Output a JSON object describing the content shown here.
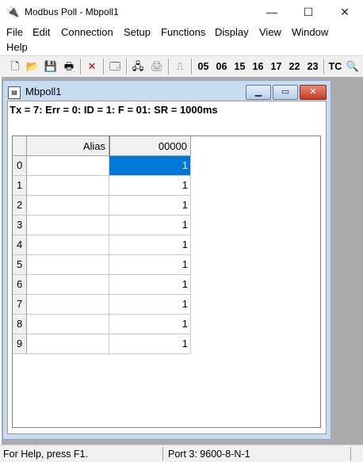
{
  "window": {
    "title": "Modbus Poll - Mbpoll1",
    "min_glyph": "—",
    "max_glyph": "☐",
    "close_glyph": "✕"
  },
  "menu": [
    "File",
    "Edit",
    "Connection",
    "Setup",
    "Functions",
    "Display",
    "View",
    "Window",
    "Help"
  ],
  "toolbar": {
    "icons": [
      "new-icon",
      "open-icon",
      "save-icon",
      "print-icon",
      "delete-icon",
      "window-icon",
      "connect-icon",
      "disconnect-icon",
      "pulse-icon"
    ],
    "function_codes": [
      "05",
      "06",
      "15",
      "16",
      "17",
      "22",
      "23"
    ],
    "tc_label": "TC"
  },
  "child": {
    "title": "Mbpoll1",
    "status_line": "Tx = 7: Err = 0: ID = 1: F = 01: SR = 1000ms",
    "grid": {
      "headers": [
        "Alias",
        "00000"
      ],
      "rows": [
        {
          "index": "0",
          "alias": "",
          "value": "1"
        },
        {
          "index": "1",
          "alias": "",
          "value": "1"
        },
        {
          "index": "2",
          "alias": "",
          "value": "1"
        },
        {
          "index": "3",
          "alias": "",
          "value": "1"
        },
        {
          "index": "4",
          "alias": "",
          "value": "1"
        },
        {
          "index": "5",
          "alias": "",
          "value": "1"
        },
        {
          "index": "6",
          "alias": "",
          "value": "1"
        },
        {
          "index": "7",
          "alias": "",
          "value": "1"
        },
        {
          "index": "8",
          "alias": "",
          "value": "1"
        },
        {
          "index": "9",
          "alias": "",
          "value": "1"
        }
      ],
      "selected_row": 0
    }
  },
  "statusbar": {
    "help": "For Help, press F1.",
    "port": "Port 3: 9600-8-N-1"
  },
  "colors": {
    "selection": "#0078d7",
    "mdi_background": "#ababab",
    "child_frame": "#c8dcf0"
  }
}
